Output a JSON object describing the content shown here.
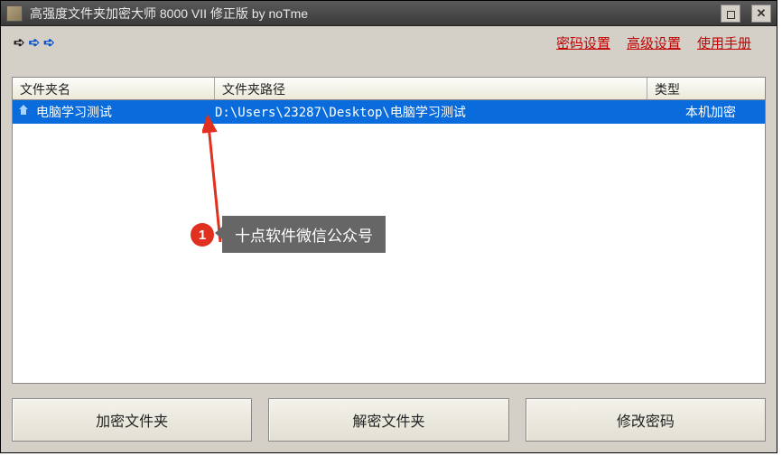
{
  "window": {
    "title": "高强度文件夹加密大师 8000 VII 修正版 by noTme"
  },
  "toolbar": {
    "links": {
      "password_settings": "密码设置",
      "advanced_settings": "高级设置",
      "manual": "使用手册"
    }
  },
  "list": {
    "headers": {
      "name": "文件夹名",
      "path": "文件夹路径",
      "type": "类型"
    },
    "rows": [
      {
        "name": "电脑学习测试",
        "path": "D:\\Users\\23287\\Desktop\\电脑学习测试",
        "type": "本机加密"
      }
    ]
  },
  "annotation": {
    "badge": "1",
    "tooltip": "十点软件微信公众号"
  },
  "buttons": {
    "encrypt": "加密文件夹",
    "decrypt": "解密文件夹",
    "change_password": "修改密码"
  }
}
